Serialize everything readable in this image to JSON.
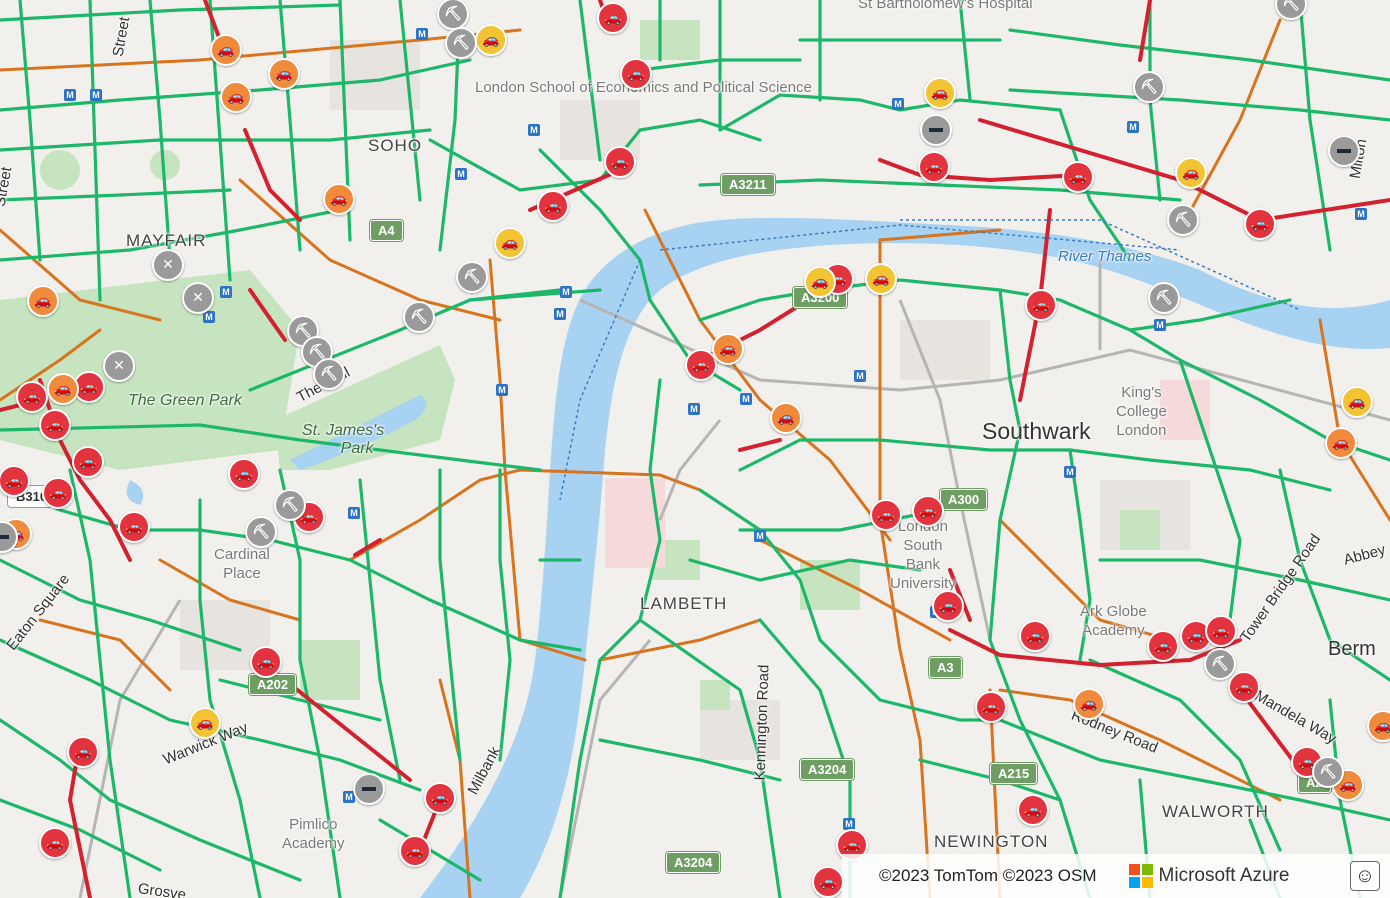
{
  "map": {
    "districts": {
      "soho": "SOHO",
      "mayfair": "MAYFAIR",
      "lambeth": "LAMBETH",
      "southwark": "Southwark",
      "newington": "NEWINGTON",
      "walworth": "WALWORTH",
      "bermondsey": "Berm"
    },
    "parks": {
      "green_park": "The Green Park",
      "st_james_line1": "St. James's",
      "st_james_line2": "Park"
    },
    "water": {
      "thames": "River Thames"
    },
    "pois": {
      "lse": "London School of Economics and Political Science",
      "st_barts": "St Bartholomew's Hospital",
      "kings_1": "King's",
      "kings_2": "College",
      "kings_3": "London",
      "lsbu_1": "London",
      "lsbu_2": "South",
      "lsbu_3": "Bank",
      "lsbu_4": "University",
      "ark_1": "Ark Globe",
      "ark_2": "Academy",
      "pimlico_1": "Pimlico",
      "pimlico_2": "Academy",
      "cardinal_1": "Cardinal",
      "cardinal_2": "Place"
    },
    "streets": {
      "the_mall": "The Mall",
      "eaton_square": "Eaton Square",
      "warwick_way": "Warwick Way",
      "milbank": "Milbank",
      "kennington_road": "Kennington Road",
      "tower_bridge_road": "Tower Bridge Road",
      "rodney_road": "Rodney Road",
      "mandela_way": "Mandela Way",
      "street_top": "Street",
      "street_left": "Street",
      "grosvenor": "Grosve",
      "abbey": "Abbey",
      "milton": "Milton"
    },
    "road_shields": {
      "a4": "A4",
      "a3211": "A3211",
      "a3200": "A3200",
      "a300": "A300",
      "a3": "A3",
      "a202": "A202",
      "a3204_mid": "A3204",
      "a3204_bot": "A3204",
      "a215": "A215",
      "a2": "A2",
      "b310": "B310"
    },
    "incident_types": [
      "traffic-jam",
      "roadworks",
      "road-closed",
      "lane-closed"
    ],
    "colors": {
      "free_flow": "#1db76a",
      "slow": "#d8731e",
      "heavy": "#d3212f",
      "river": "#a8d2f2",
      "park": "#c6e4bf",
      "incident_jam": "#e2333f",
      "incident_minor": "#f08a3c",
      "incident_caution": "#f2c433",
      "incident_works": "#9a9a9a"
    }
  },
  "attribution": {
    "copyright": "©2023 TomTom ©2023 OSM",
    "brand": "Microsoft Azure"
  }
}
